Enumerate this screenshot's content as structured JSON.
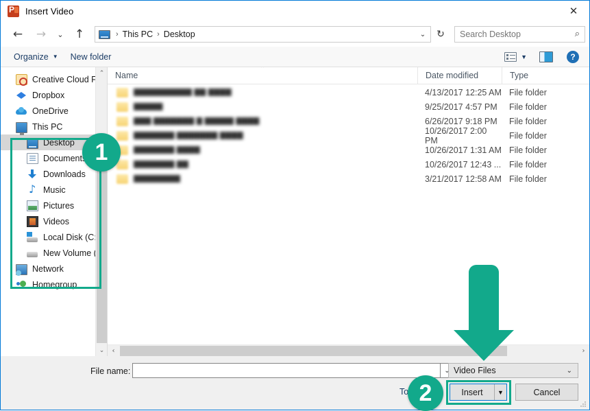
{
  "window": {
    "title": "Insert Video",
    "app_icon": "powerpoint-icon",
    "close_label": "✕"
  },
  "navigation": {
    "back_icon": "←",
    "forward_icon": "→",
    "recent_icon": "⌄",
    "up_icon": "↑",
    "refresh_icon": "↻",
    "breadcrumb": [
      "This PC",
      "Desktop"
    ],
    "breadcrumb_separator": "›",
    "address_dropdown_icon": "⌄"
  },
  "search": {
    "placeholder": "Search Desktop",
    "value": "",
    "icon": "⌕"
  },
  "command_bar": {
    "organize_label": "Organize",
    "organize_caret": "▼",
    "new_folder_label": "New folder",
    "view_caret": "▼",
    "help_label": "?"
  },
  "sidebar": {
    "scroll_up_icon": "⌃",
    "scroll_down_icon": "⌄",
    "items": [
      {
        "label": "Creative Cloud Fil",
        "icon": "creative-cloud-icon",
        "icon_class": "ic-cc",
        "level": "root",
        "selected": false
      },
      {
        "label": "Dropbox",
        "icon": "dropbox-icon",
        "icon_class": "ic-dropbox",
        "level": "root",
        "selected": false
      },
      {
        "label": "OneDrive",
        "icon": "onedrive-icon",
        "icon_class": "ic-onedrive",
        "level": "root",
        "selected": false
      },
      {
        "label": "This PC",
        "icon": "this-pc-icon",
        "icon_class": "ic-thispc",
        "level": "root",
        "selected": false
      },
      {
        "label": "Desktop",
        "icon": "desktop-icon",
        "icon_class": "ic-desktop",
        "level": "child",
        "selected": true
      },
      {
        "label": "Documents",
        "icon": "documents-icon",
        "icon_class": "ic-docs",
        "level": "child",
        "selected": false
      },
      {
        "label": "Downloads",
        "icon": "downloads-icon",
        "icon_class": "ic-dl",
        "level": "child",
        "selected": false
      },
      {
        "label": "Music",
        "icon": "music-icon",
        "icon_class": "ic-music",
        "level": "child",
        "selected": false
      },
      {
        "label": "Pictures",
        "icon": "pictures-icon",
        "icon_class": "ic-pics",
        "level": "child",
        "selected": false
      },
      {
        "label": "Videos",
        "icon": "videos-icon",
        "icon_class": "ic-video",
        "level": "child",
        "selected": false
      },
      {
        "label": "Local Disk (C:)",
        "icon": "local-disk-icon",
        "icon_class": "ic-disk",
        "level": "child",
        "selected": false
      },
      {
        "label": "New Volume (E:)",
        "icon": "volume-icon",
        "icon_class": "ic-vol",
        "level": "child",
        "selected": false
      },
      {
        "label": "Network",
        "icon": "network-icon",
        "icon_class": "ic-net",
        "level": "root",
        "selected": false
      },
      {
        "label": "Homegroup",
        "icon": "homegroup-icon",
        "icon_class": "ic-home",
        "level": "root",
        "selected": false
      }
    ]
  },
  "file_list": {
    "columns": [
      "Name",
      "Date modified",
      "Type"
    ],
    "sort_caret": "⌃",
    "rows": [
      {
        "name": "██████████ ██ ████",
        "date_modified": "4/13/2017 12:25 AM",
        "type": "File folder"
      },
      {
        "name": "█████",
        "date_modified": "9/25/2017 4:57 PM",
        "type": "File folder"
      },
      {
        "name": "███ ███████    █ █████ ████",
        "date_modified": "6/26/2017 9:18 PM",
        "type": "File folder"
      },
      {
        "name": "███████ ███████ ████",
        "date_modified": "10/26/2017 2:00 PM",
        "type": "File folder"
      },
      {
        "name": "███████ ████",
        "date_modified": "10/26/2017 1:31 AM",
        "type": "File folder"
      },
      {
        "name": "███████ ██",
        "date_modified": "10/26/2017 12:43 ...",
        "type": "File folder"
      },
      {
        "name": "████████",
        "date_modified": "3/21/2017 12:58 AM",
        "type": "File folder"
      }
    ],
    "h_scroll_left_icon": "‹",
    "h_scroll_right_icon": "›"
  },
  "footer": {
    "file_name_label": "File name:",
    "file_name_value": "",
    "file_name_dropdown_icon": "⌄",
    "filter_value": "Video Files",
    "filter_caret": "⌄",
    "tools_label": "To",
    "insert_label": "Insert",
    "insert_split_caret": "▼",
    "cancel_label": "Cancel"
  },
  "annotations": {
    "accent_color": "#12a98b",
    "focus_color": "#0078d7",
    "badges": [
      {
        "number": "1",
        "target": "sidebar-folder-tree"
      },
      {
        "number": "2",
        "target": "insert-button"
      }
    ],
    "arrow": {
      "direction": "down",
      "target": "file-type-filter-dropdown"
    }
  }
}
